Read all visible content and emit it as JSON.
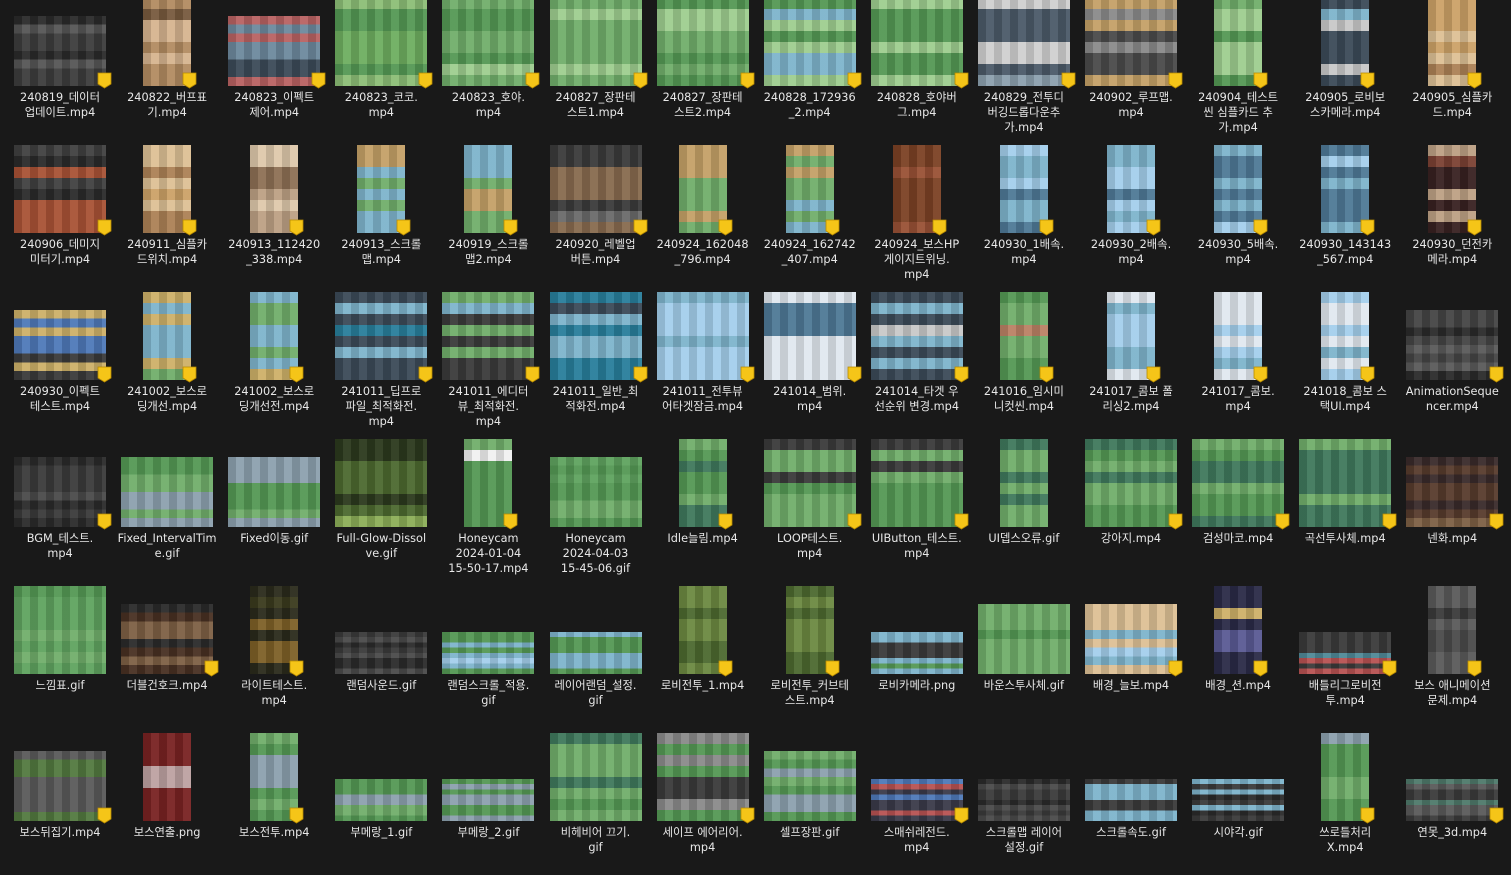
{
  "files": [
    {
      "name": "240819_데이터\n업데이트.mp4",
      "kind": "wide",
      "colors": [
        "#2a2a2a",
        "#3c3c3c",
        "#555555"
      ],
      "badge": true
    },
    {
      "name": "240822_버프표\n기.mp4",
      "kind": "tall",
      "colors": [
        "#b68a5c",
        "#d9b48a",
        "#7a5a3a"
      ],
      "badge": true
    },
    {
      "name": "240823_이펙트\n제어.mp4",
      "kind": "wide",
      "colors": [
        "#3a4a5a",
        "#6a8aa0",
        "#c06060"
      ],
      "badge": true
    },
    {
      "name": "240823_코코.\nmp4",
      "kind": "square",
      "colors": [
        "#4f9a4f",
        "#69b05a",
        "#88c070"
      ],
      "badge": true
    },
    {
      "name": "240823_호야.\nmp4",
      "kind": "square",
      "colors": [
        "#4f9a4f",
        "#6cb065",
        "#9ad08a"
      ],
      "badge": true
    },
    {
      "name": "240827_장판테\n스트1.mp4",
      "kind": "square",
      "colors": [
        "#4f9a4f",
        "#6cb065",
        "#9ad08a"
      ],
      "badge": true
    },
    {
      "name": "240827_장판테\n스트2.mp4",
      "kind": "square",
      "colors": [
        "#4f9a4f",
        "#6cb065",
        "#9ad08a"
      ],
      "badge": true
    },
    {
      "name": "240828_172936\n_2.mp4",
      "kind": "square",
      "colors": [
        "#4f9a4f",
        "#79b5d0",
        "#9ad08a"
      ],
      "badge": true
    },
    {
      "name": "240828_호야버\n그.mp4",
      "kind": "square",
      "colors": [
        "#4f9a4f",
        "#6cb065",
        "#9ad08a"
      ],
      "badge": true
    },
    {
      "name": "240829_전투디\n버깅드롭다운추\n가.mp4",
      "kind": "square",
      "colors": [
        "#4a5a6a",
        "#8aa0b0",
        "#d0d0d0"
      ],
      "badge": true
    },
    {
      "name": "240902_루프맵.\nmp4",
      "kind": "square",
      "colors": [
        "#4a4a4a",
        "#c8a060",
        "#8a8a8a"
      ],
      "badge": true
    },
    {
      "name": "240904_테스트\n씬 심플카드 추\n가.mp4",
      "kind": "tall",
      "colors": [
        "#4f9a4f",
        "#6cb065",
        "#9ad08a"
      ],
      "badge": true
    },
    {
      "name": "240905_로비보\n스카메라.mp4",
      "kind": "tall",
      "colors": [
        "#3a4a5a",
        "#79b5d0",
        "#c8c8c8"
      ],
      "badge": true
    },
    {
      "name": "240905_심플카\n드.mp4",
      "kind": "tall",
      "colors": [
        "#d0a060",
        "#b08050",
        "#e0c090"
      ],
      "badge": true
    },
    {
      "name": "240906_데미지\n미터기.mp4",
      "kind": "square",
      "colors": [
        "#2a2a2a",
        "#b05030",
        "#404040"
      ],
      "badge": true
    },
    {
      "name": "240911_심플카\n드위치.mp4",
      "kind": "tall",
      "colors": [
        "#d0a060",
        "#b08050",
        "#e0c090"
      ],
      "badge": true
    },
    {
      "name": "240913_112420\n_338.mp4",
      "kind": "tall",
      "colors": [
        "#c0a080",
        "#e0c8a8",
        "#907050"
      ],
      "badge": true
    },
    {
      "name": "240913_스크롤\n맵.mp4",
      "kind": "tall",
      "colors": [
        "#79b5d0",
        "#c8a060",
        "#6cb065"
      ],
      "badge": true
    },
    {
      "name": "240919_스크롤\n맵2.mp4",
      "kind": "tall",
      "colors": [
        "#79b5d0",
        "#c8a060",
        "#6cb065"
      ],
      "badge": true
    },
    {
      "name": "240920_레벨업\n버튼.mp4",
      "kind": "square",
      "colors": [
        "#3a3a3a",
        "#8a6a4a",
        "#6a6a6a"
      ],
      "badge": true
    },
    {
      "name": "240924_162048\n_796.mp4",
      "kind": "tall",
      "colors": [
        "#79b5d0",
        "#6cb065",
        "#c8a060"
      ],
      "badge": true
    },
    {
      "name": "240924_162742\n_407.mp4",
      "kind": "tall",
      "colors": [
        "#79b5d0",
        "#6cb065",
        "#c8a060"
      ],
      "badge": true
    },
    {
      "name": "240924_보스HP\n게이지트위닝.\nmp4",
      "kind": "tall",
      "colors": [
        "#a05030",
        "#804020",
        "#d08060"
      ],
      "badge": true
    },
    {
      "name": "240930_1배속.\nmp4",
      "kind": "tall",
      "colors": [
        "#79b5d0",
        "#a0d0f0",
        "#4a7a9a"
      ],
      "badge": true
    },
    {
      "name": "240930_2배속.\nmp4",
      "kind": "tall",
      "colors": [
        "#79b5d0",
        "#a0d0f0",
        "#4a7a9a"
      ],
      "badge": true
    },
    {
      "name": "240930_5배속.\nmp4",
      "kind": "tall",
      "colors": [
        "#79b5d0",
        "#a0d0f0",
        "#4a7a9a"
      ],
      "badge": true
    },
    {
      "name": "240930_143143\n_567.mp4",
      "kind": "tall",
      "colors": [
        "#79b5d0",
        "#a0d0f0",
        "#4a7a9a"
      ],
      "badge": true
    },
    {
      "name": "240930_던전카\n메라.mp4",
      "kind": "tall",
      "colors": [
        "#3a2020",
        "#804030",
        "#c0a080"
      ],
      "badge": true
    },
    {
      "name": "240930_이펙트\n테스트.mp4",
      "kind": "wide",
      "colors": [
        "#4a7ac0",
        "#d0b060",
        "#3a3a3a"
      ],
      "badge": true
    },
    {
      "name": "241002_보스로\n딩개선.mp4",
      "kind": "tall",
      "colors": [
        "#79b5d0",
        "#d0b060",
        "#6cb065"
      ],
      "badge": true
    },
    {
      "name": "241002_보스로\n딩개선전.mp4",
      "kind": "tall",
      "colors": [
        "#79b5d0",
        "#d0b060",
        "#6cb065"
      ],
      "badge": true
    },
    {
      "name": "241011_딥프로\n파일_최적화전.\nmp4",
      "kind": "square",
      "colors": [
        "#3a4a5a",
        "#79b5d0",
        "#2080a0"
      ],
      "badge": true
    },
    {
      "name": "241011_에디터\n뷰_최적화전.\nmp4",
      "kind": "square",
      "colors": [
        "#3a3a3a",
        "#79b5d0",
        "#6cb065"
      ],
      "badge": true
    },
    {
      "name": "241011_일반_최\n적화전.mp4",
      "kind": "square",
      "colors": [
        "#3a4a5a",
        "#79b5d0",
        "#2080a0"
      ],
      "badge": true
    },
    {
      "name": "241011_전투뷰\n어타겟잠금.mp4",
      "kind": "square",
      "colors": [
        "#3a3a3a",
        "#79b5d0",
        "#a0d0f0"
      ],
      "badge": true
    },
    {
      "name": "241014_범위.\nmp4",
      "kind": "square",
      "colors": [
        "#79b5d0",
        "#e0e8f0",
        "#4a7a9a"
      ],
      "badge": true
    },
    {
      "name": "241014_타겟 우\n선순위 변경.mp4",
      "kind": "square",
      "colors": [
        "#3a4a5a",
        "#79b5d0",
        "#c8c8c8"
      ],
      "badge": true
    },
    {
      "name": "241016_임시미\n니컷씬.mp4",
      "kind": "tall",
      "colors": [
        "#4f9a4f",
        "#6cb065",
        "#c08060"
      ],
      "badge": true
    },
    {
      "name": "241017_콤보 폴\n리싱2.mp4",
      "kind": "tall",
      "colors": [
        "#79b5d0",
        "#a0d0f0",
        "#e0e8f0"
      ],
      "badge": true
    },
    {
      "name": "241017_콤보.\nmp4",
      "kind": "tall",
      "colors": [
        "#79b5d0",
        "#a0d0f0",
        "#e0e8f0"
      ],
      "badge": true
    },
    {
      "name": "241018_콤보 스\n택UI.mp4",
      "kind": "tall",
      "colors": [
        "#79b5d0",
        "#a0d0f0",
        "#e0e8f0"
      ],
      "badge": true
    },
    {
      "name": "AnimationSeque\nncer.mp4",
      "kind": "wide",
      "colors": [
        "#2a2a2a",
        "#444444",
        "#5a5a5a"
      ],
      "badge": true
    },
    {
      "name": "BGM_테스트.\nmp4",
      "kind": "wide",
      "colors": [
        "#2a2a2a",
        "#3a3a3a",
        "#4a4a4a"
      ],
      "badge": true
    },
    {
      "name": "Fixed_IntervalTim\ne.gif",
      "kind": "wide",
      "colors": [
        "#4f9a4f",
        "#6cb065",
        "#8aa0b0"
      ],
      "badge": false
    },
    {
      "name": "Fixed이동.gif",
      "kind": "wide",
      "colors": [
        "#4f9a4f",
        "#6cb065",
        "#8aa0b0"
      ],
      "badge": false
    },
    {
      "name": "Full-Glow-Dissol\nve.gif",
      "kind": "square",
      "colors": [
        "#4a6a2a",
        "#8ab050",
        "#2a3a1a"
      ],
      "badge": false
    },
    {
      "name": "Honeycam\n2024-01-04\n15-50-17.mp4",
      "kind": "tall",
      "colors": [
        "#4f9a4f",
        "#f0f0f0",
        "#6cb065"
      ],
      "badge": true
    },
    {
      "name": "Honeycam\n2024-04-03\n15-45-06.gif",
      "kind": "wide",
      "colors": [
        "#4f9a4f",
        "#5aa55a",
        "#6cb065"
      ],
      "badge": false
    },
    {
      "name": "Idle늘림.mp4",
      "kind": "tall",
      "colors": [
        "#4f9a4f",
        "#6cb065",
        "#3a7a5a"
      ],
      "badge": true
    },
    {
      "name": "LOOP테스트.\nmp4",
      "kind": "square",
      "colors": [
        "#3a3a3a",
        "#4f9a4f",
        "#6cb065"
      ],
      "badge": true
    },
    {
      "name": "UIButton_테스트.\nmp4",
      "kind": "square",
      "colors": [
        "#3a3a3a",
        "#4f9a4f",
        "#6cb065"
      ],
      "badge": true
    },
    {
      "name": "UI뎁스오류.gif",
      "kind": "tall",
      "colors": [
        "#4f9a4f",
        "#6cb065",
        "#3a7a5a"
      ],
      "badge": false
    },
    {
      "name": "강아지.mp4",
      "kind": "square",
      "colors": [
        "#4f9a4f",
        "#6cb065",
        "#3a7a5a"
      ],
      "badge": true
    },
    {
      "name": "검성마코.mp4",
      "kind": "square",
      "colors": [
        "#4f9a4f",
        "#6cb065",
        "#3a7a5a"
      ],
      "badge": true
    },
    {
      "name": "곡선투사체.mp4",
      "kind": "square",
      "colors": [
        "#4f9a4f",
        "#6cb065",
        "#3a7a5a"
      ],
      "badge": true
    },
    {
      "name": "넨화.mp4",
      "kind": "wide",
      "colors": [
        "#3a2a2a",
        "#806040",
        "#5a3a2a"
      ],
      "badge": true
    },
    {
      "name": "느낌표.gif",
      "kind": "square",
      "colors": [
        "#4f9a4f",
        "#5aa55a",
        "#6cb065"
      ],
      "badge": false
    },
    {
      "name": "더블건호크.mp4",
      "kind": "wide",
      "colors": [
        "#4a3020",
        "#806040",
        "#2a2a2a"
      ],
      "badge": true
    },
    {
      "name": "라이트테스트.\nmp4",
      "kind": "tall",
      "colors": [
        "#3a3a1a",
        "#806020",
        "#2a2a1a"
      ],
      "badge": true
    },
    {
      "name": "랜덤사운드.gif",
      "kind": "wide-short",
      "colors": [
        "#2a2a2a",
        "#3a3a3a",
        "#4a4a4a"
      ],
      "badge": false
    },
    {
      "name": "랜덤스크롤_적용.\ngif",
      "kind": "wide-short",
      "colors": [
        "#79b5d0",
        "#4f9a4f",
        "#a0d0f0"
      ],
      "badge": false
    },
    {
      "name": "레이어랜덤_설정.\ngif",
      "kind": "wide-short",
      "colors": [
        "#79b5d0",
        "#4f9a4f",
        "#a0d0f0"
      ],
      "badge": false
    },
    {
      "name": "로비전투_1.mp4",
      "kind": "tall",
      "colors": [
        "#6a8a3a",
        "#8ab050",
        "#4a6a2a"
      ],
      "badge": true
    },
    {
      "name": "로비전투_커브테\n스트.mp4",
      "kind": "tall",
      "colors": [
        "#6a8a3a",
        "#8ab050",
        "#4a6a2a"
      ],
      "badge": true
    },
    {
      "name": "로비카메라.png",
      "kind": "wide-short",
      "colors": [
        "#3a3a3a",
        "#4f9a4f",
        "#79b5d0"
      ],
      "badge": false
    },
    {
      "name": "바운스투사체.gif",
      "kind": "wide",
      "colors": [
        "#4f9a4f",
        "#6cb065",
        "#8aa0b0"
      ],
      "badge": false
    },
    {
      "name": "배경_늘보.mp4",
      "kind": "wide",
      "colors": [
        "#79b5d0",
        "#e0c090",
        "#a0d0f0"
      ],
      "badge": true
    },
    {
      "name": "배경_션.mp4",
      "kind": "tall",
      "colors": [
        "#2a2a4a",
        "#5a5a9a",
        "#d0b060"
      ],
      "badge": true
    },
    {
      "name": "배틀리그로비전\n투.mp4",
      "kind": "wide-short",
      "colors": [
        "#3a3a3a",
        "#4a8a9a",
        "#c05050"
      ],
      "badge": true
    },
    {
      "name": "보스 애니메이션\n문제.mp4",
      "kind": "tall",
      "colors": [
        "#3a3a3a",
        "#4a4a4a",
        "#5a5a5a"
      ],
      "badge": true
    },
    {
      "name": "보스뒤집기.mp4",
      "kind": "wide",
      "colors": [
        "#3a3a3a",
        "#4f7a3a",
        "#5a5a5a"
      ],
      "badge": true
    },
    {
      "name": "보스연출.png",
      "kind": "tall",
      "colors": [
        "#3a1a1a",
        "#802020",
        "#c0a0a0"
      ],
      "badge": false
    },
    {
      "name": "보스전투.mp4",
      "kind": "tall",
      "colors": [
        "#4f9a4f",
        "#6cb065",
        "#8aa0b0"
      ],
      "badge": true
    },
    {
      "name": "부메랑_1.gif",
      "kind": "wide-short",
      "colors": [
        "#4f9a4f",
        "#6cb065",
        "#8aa0b0"
      ],
      "badge": false
    },
    {
      "name": "부메랑_2.gif",
      "kind": "wide-short",
      "colors": [
        "#4f9a4f",
        "#6cb065",
        "#8aa0b0"
      ],
      "badge": false
    },
    {
      "name": "비헤비어 끄기.\ngif",
      "kind": "square",
      "colors": [
        "#4f9a4f",
        "#6cb065",
        "#3a7a5a"
      ],
      "badge": false
    },
    {
      "name": "세이프 에어리어.\nmp4",
      "kind": "square",
      "colors": [
        "#3a3a3a",
        "#4f9a4f",
        "#8a8a8a"
      ],
      "badge": true
    },
    {
      "name": "셀프장판.gif",
      "kind": "wide",
      "colors": [
        "#4f9a4f",
        "#6cb065",
        "#8aa0b0"
      ],
      "badge": false
    },
    {
      "name": "스매쉬레전드.\nmp4",
      "kind": "wide-short",
      "colors": [
        "#3a3a4a",
        "#4a7ac0",
        "#c05050"
      ],
      "badge": true
    },
    {
      "name": "스크롤맵 레이어\n설정.gif",
      "kind": "wide-short",
      "colors": [
        "#2a2a2a",
        "#3a3a3a",
        "#4a4a4a"
      ],
      "badge": false
    },
    {
      "name": "스크롤속도.gif",
      "kind": "wide-short",
      "colors": [
        "#3a3a3a",
        "#79b5d0",
        "#d0b060"
      ],
      "badge": false
    },
    {
      "name": "시야각.gif",
      "kind": "wide-short",
      "colors": [
        "#2a2a2a",
        "#3a3a3a",
        "#79b5d0"
      ],
      "badge": false
    },
    {
      "name": "쓰로틀처리\nX.mp4",
      "kind": "tall",
      "colors": [
        "#4f9a4f",
        "#6cb065",
        "#8aa0b0"
      ],
      "badge": true
    },
    {
      "name": "연못_3d.mp4",
      "kind": "wide-short",
      "colors": [
        "#3a3a3a",
        "#4a7a6a",
        "#5a5a5a"
      ],
      "badge": true
    }
  ]
}
